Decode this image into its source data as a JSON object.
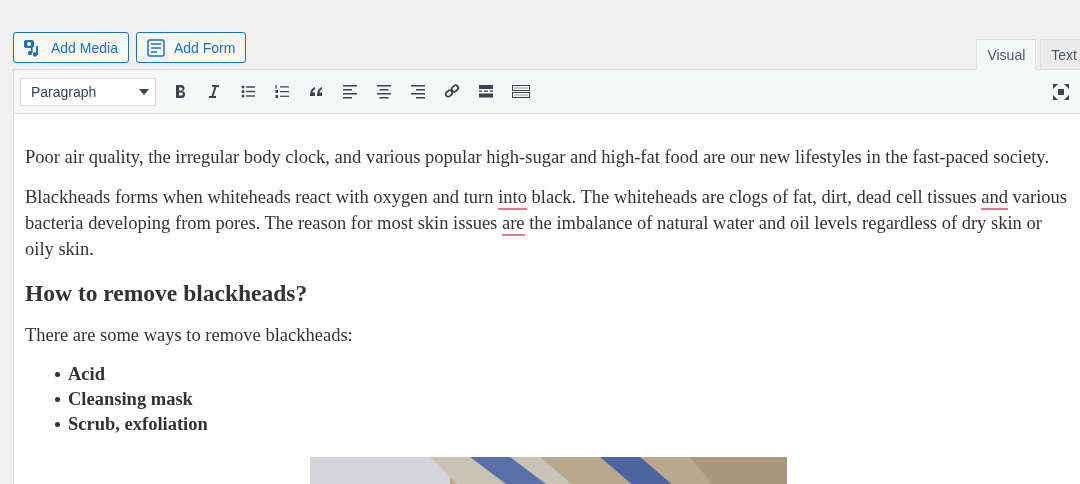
{
  "media_buttons": [
    {
      "kind": "media",
      "label": "Add Media"
    },
    {
      "kind": "form",
      "label": "Add Form"
    }
  ],
  "tabs": [
    {
      "label": "Visual",
      "selected": true
    },
    {
      "label": "Text",
      "selected": false
    }
  ],
  "toolbar": {
    "format_select": "Paragraph",
    "tools": [
      {
        "kind": "bold"
      },
      {
        "kind": "italic"
      },
      {
        "kind": "bullet-list"
      },
      {
        "kind": "numbered-list"
      },
      {
        "kind": "quote"
      },
      {
        "kind": "align-left"
      },
      {
        "kind": "align-center"
      },
      {
        "kind": "align-right"
      },
      {
        "kind": "link"
      },
      {
        "kind": "read-more"
      },
      {
        "kind": "toolbar-toggle"
      }
    ]
  },
  "content": [
    {
      "kind": "paragraph",
      "segments": [
        {
          "text": "Poor air quality, the irregular body clock, and various popular high-sugar and high-fat food are our new lifestyles in the fast-paced society.",
          "flagged": false
        }
      ]
    },
    {
      "kind": "paragraph",
      "segments": [
        {
          "text": "Blackheads forms when whiteheads react with oxygen and turn ",
          "flagged": false
        },
        {
          "text": "into",
          "flagged": true
        },
        {
          "text": " black. The whiteheads are clogs of fat, dirt, dead cell tissues ",
          "flagged": false
        },
        {
          "text": "and",
          "flagged": true
        },
        {
          "text": " various bacteria developing from pores. The reason for most skin issues ",
          "flagged": false
        },
        {
          "text": "are",
          "flagged": true
        },
        {
          "text": " the imbalance of natural water and oil levels regardless of dry skin or oily skin.",
          "flagged": false
        }
      ]
    },
    {
      "kind": "heading",
      "text": "How to remove blackheads?"
    },
    {
      "kind": "paragraph",
      "segments": [
        {
          "text": "There are some ways to remove blackheads:",
          "flagged": false
        }
      ]
    },
    {
      "kind": "list",
      "items": [
        "Acid",
        "Cleansing mask",
        "Scrub, exfoliation"
      ]
    },
    {
      "kind": "picture"
    }
  ]
}
